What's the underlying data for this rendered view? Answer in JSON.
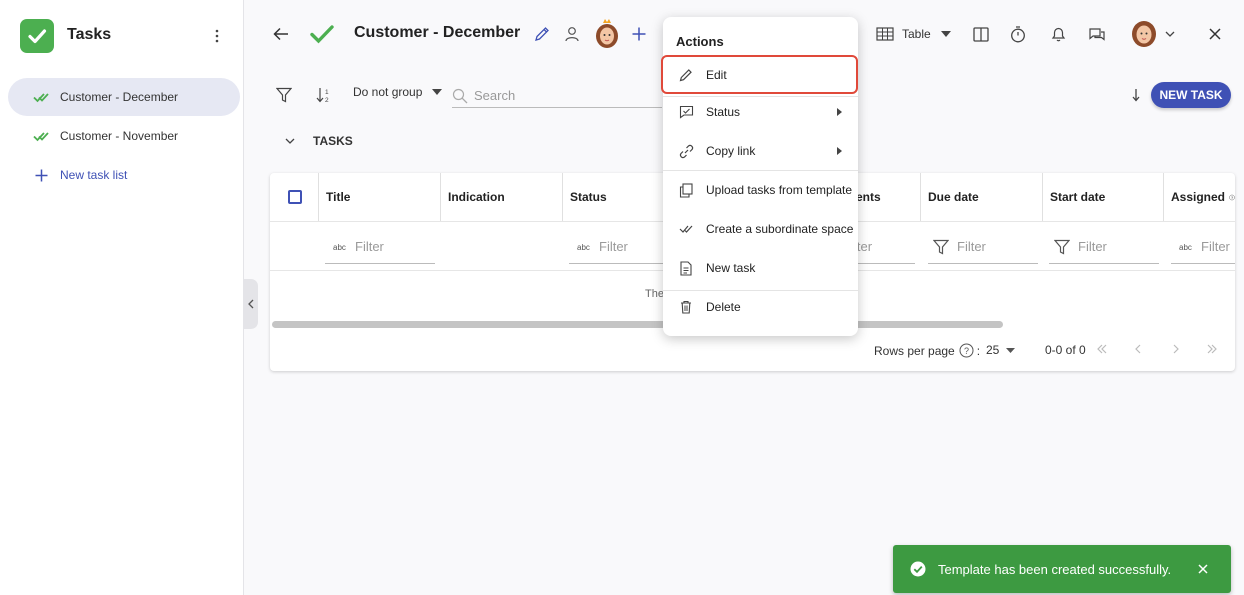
{
  "sidebar": {
    "app_title": "Tasks",
    "items": [
      {
        "label": "Customer - December",
        "active": true
      },
      {
        "label": "Customer - November",
        "active": false
      }
    ],
    "new_list_label": "New task list"
  },
  "header": {
    "title": "Customer - December",
    "view_label": "Table"
  },
  "toolbar": {
    "group_label": "Do not group",
    "search_placeholder": "Search",
    "new_task_label": "NEW TASK"
  },
  "section": {
    "title": "TASKS"
  },
  "table": {
    "columns": [
      "Title",
      "Indication",
      "Status",
      "",
      "Due date",
      "Start date",
      "Assigned"
    ],
    "partial_col_text": "ents",
    "filter_placeholder": "Filter",
    "partial_filter_text": "lter",
    "empty_text": "The",
    "rows_per_page_label": "Rows per page",
    "rows_per_page_value": "25",
    "page_range": "0-0 of 0"
  },
  "actions_menu": {
    "title": "Actions",
    "items": [
      {
        "label": "Edit",
        "icon": "pencil-icon"
      },
      {
        "label": "Status",
        "icon": "status-icon"
      },
      {
        "label": "Copy link",
        "icon": "link-icon"
      },
      {
        "label": "Upload tasks from template",
        "icon": "template-icon"
      },
      {
        "label": "Create a subordinate space",
        "icon": "checkmarks-icon"
      },
      {
        "label": "New task",
        "icon": "document-icon"
      },
      {
        "label": "Delete",
        "icon": "trash-icon"
      }
    ]
  },
  "toast": {
    "message": "Template has been created successfully."
  },
  "colors": {
    "accent": "#3f51b5",
    "success": "#4caf50",
    "toast_bg": "#3d9a41",
    "highlight": "#e0493a"
  }
}
